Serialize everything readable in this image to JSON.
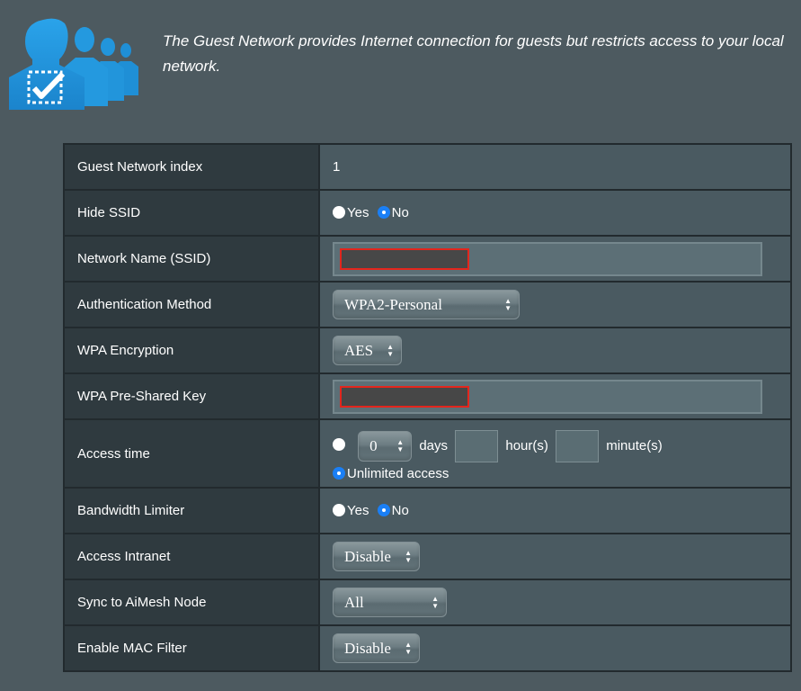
{
  "header": {
    "icon": "guest-users-icon",
    "description": "The Guest Network provides Internet connection for guests but restricts access to your local network."
  },
  "rows": {
    "guest_index": {
      "label": "Guest Network index",
      "value": "1"
    },
    "hide_ssid": {
      "label": "Hide SSID",
      "options": [
        "Yes",
        "No"
      ],
      "selected": "No"
    },
    "ssid": {
      "label": "Network Name (SSID)",
      "value": "[redacted]"
    },
    "auth_method": {
      "label": "Authentication Method",
      "selected": "WPA2-Personal"
    },
    "wpa_encryption": {
      "label": "WPA Encryption",
      "selected": "AES"
    },
    "psk": {
      "label": "WPA Pre-Shared Key",
      "value": "[redacted]"
    },
    "access_time": {
      "label": "Access time",
      "days_value": "0",
      "days_label": "days",
      "hours_label": "hour(s)",
      "minutes_label": "minute(s)",
      "hours_value": "",
      "minutes_value": "",
      "unlimited_label": "Unlimited access",
      "selected": "Unlimited access"
    },
    "bandwidth": {
      "label": "Bandwidth Limiter",
      "options": [
        "Yes",
        "No"
      ],
      "selected": "No"
    },
    "intranet": {
      "label": "Access Intranet",
      "selected": "Disable"
    },
    "aimesh": {
      "label": "Sync to AiMesh Node",
      "selected": "All"
    },
    "mac_filter": {
      "label": "Enable MAC Filter",
      "selected": "Disable"
    }
  },
  "colors": {
    "radio_selected": "#1a7ff5",
    "redaction_border": "#e3261d",
    "icon_blue": "#2a9be0"
  }
}
